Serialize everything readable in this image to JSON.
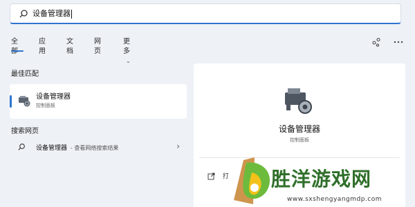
{
  "search": {
    "value": "设备管理器"
  },
  "tabs": [
    {
      "label": "全部"
    },
    {
      "label": "应用"
    },
    {
      "label": "文档"
    },
    {
      "label": "网页"
    },
    {
      "label": "更多"
    }
  ],
  "sections": {
    "best_match_title": "最佳匹配",
    "web_title": "搜索网页"
  },
  "best_match": {
    "name": "设备管理器",
    "subtitle": "控制面板"
  },
  "web_result": {
    "name": "设备管理器",
    "suffix": "- 查看网络搜索结果"
  },
  "detail": {
    "name": "设备管理器",
    "subtitle": "控制面板",
    "open_label": "打"
  },
  "watermark": {
    "text": "胜洋游戏网",
    "url": "www.sxshengyangmdp.com"
  },
  "colors": {
    "accent": "#2f74d0",
    "watermark_green": "#2f6f2a"
  },
  "icons": [
    "search-icon",
    "share-icon",
    "more-icon",
    "device-manager-icon",
    "open-icon",
    "chevron-right-icon"
  ]
}
